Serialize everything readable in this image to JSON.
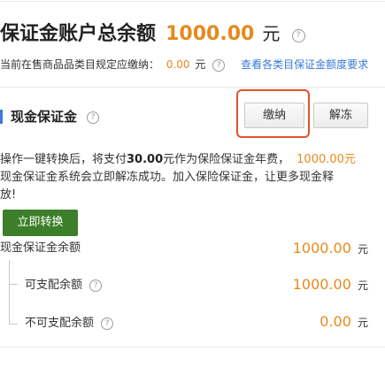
{
  "header": {
    "title": "保证金账户总余额",
    "amount": "1000.00",
    "unit": "元"
  },
  "subheader": {
    "text": "当前在售商品品类目规定应缴纳：",
    "amount": "0.00",
    "unit": "元",
    "link": "查看各类目保证金额度要求"
  },
  "cash_deposit": {
    "title": "现金保证金",
    "pay_button": "缴纳",
    "unfreeze_button": "解冻",
    "desc_prefix": "操作一键转换后，将支付",
    "desc_fee": "30.00",
    "desc_mid": "元作为保险保证金年费，",
    "desc_amount": "1000.00元",
    "desc_line2": "现金保证金系统会立即解冻成功。加入保险保证金，让更多现金释",
    "desc_line3": "放!",
    "convert_button": "立即转换"
  },
  "balances": {
    "total_label": "现金保证金余额",
    "total_value": "1000.00",
    "available_label": "可支配余额",
    "available_value": "1000.00",
    "unavailable_label": "不可支配余额",
    "unavailable_value": "0.00",
    "unit": "元"
  },
  "colors": {
    "accent_orange": "#e58a1f",
    "link_blue": "#3a7bd5",
    "highlight_red": "#e0532f",
    "convert_green": "#3c7e2a"
  }
}
